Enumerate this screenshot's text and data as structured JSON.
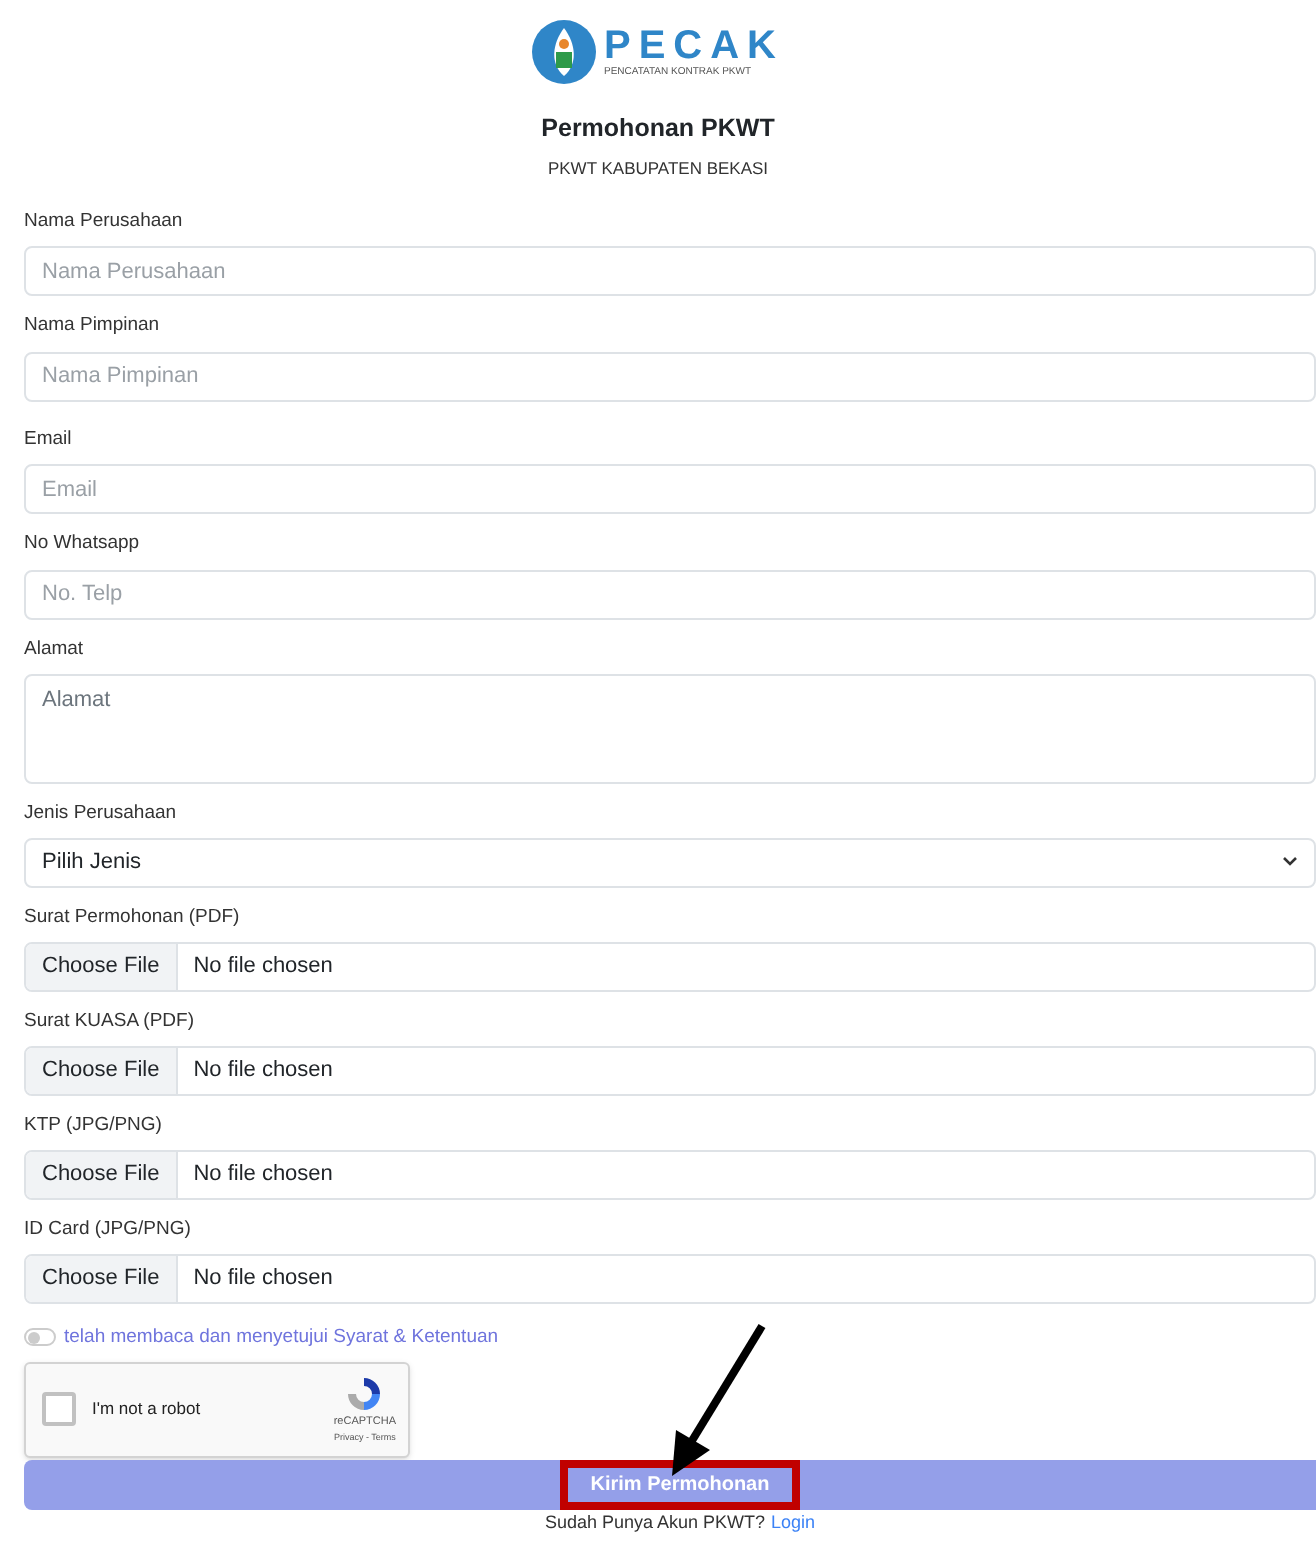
{
  "logo": {
    "name": "PECAK",
    "tagline": "PENCATATAN KONTRAK PKWT"
  },
  "title": "Permohonan PKWT",
  "subtitle": "PKWT KABUPATEN BEKASI",
  "fields": [
    {
      "kind": "text",
      "label": "Nama Perusahaan",
      "placeholder": "Nama Perusahaan"
    },
    {
      "kind": "text",
      "label": "Nama Pimpinan",
      "placeholder": "Nama Pimpinan"
    },
    {
      "kind": "text",
      "label": "Email",
      "placeholder": "Email"
    },
    {
      "kind": "text",
      "label": "No Whatsapp",
      "placeholder": "No. Telp"
    },
    {
      "kind": "textarea",
      "label": "Alamat",
      "placeholder": "Alamat"
    },
    {
      "kind": "select",
      "label": "Jenis Perusahaan",
      "value": "Pilih Jenis"
    },
    {
      "kind": "file",
      "label": "Surat Permohonan (PDF)",
      "button": "Choose File",
      "status": "No file chosen"
    },
    {
      "kind": "file",
      "label": "Surat KUASA (PDF)",
      "button": "Choose File",
      "status": "No file chosen"
    },
    {
      "kind": "file",
      "label": "KTP (JPG/PNG)",
      "button": "Choose File",
      "status": "No file chosen"
    },
    {
      "kind": "file",
      "label": "ID Card (JPG/PNG)",
      "button": "Choose File",
      "status": "No file chosen"
    }
  ],
  "agreement": {
    "on": false,
    "label": "telah membaca dan menyetujui Syarat & Ketentuan"
  },
  "captcha": {
    "checked": false,
    "label": "I'm not a robot",
    "brand": "reCAPTCHA",
    "links": "Privacy - Terms"
  },
  "submit": {
    "label": "Kirim Permohonan",
    "highlighted": true
  },
  "footer": {
    "text": "Sudah Punya Akun PKWT?",
    "link": "Login"
  }
}
